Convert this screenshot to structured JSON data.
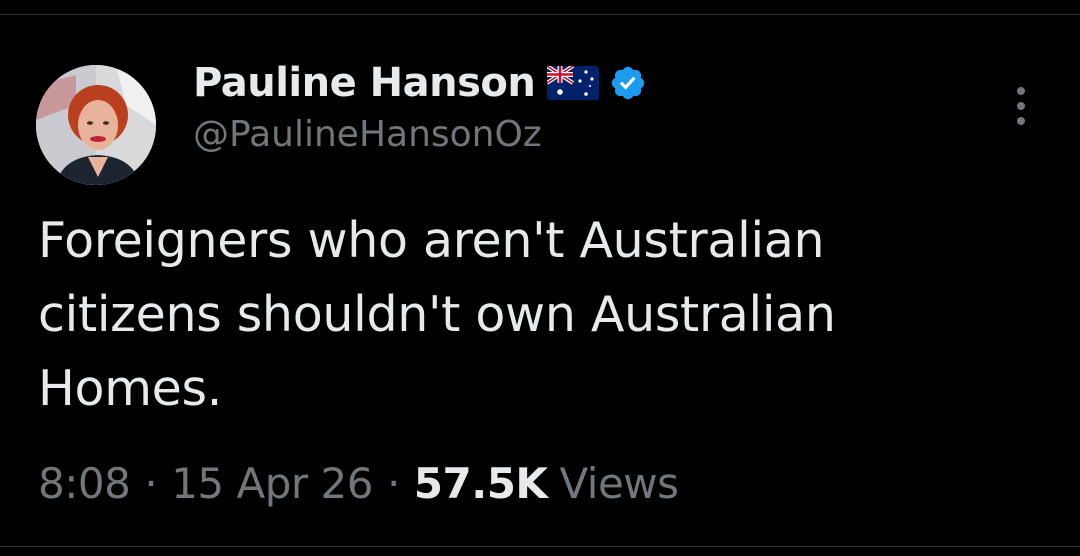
{
  "tweet": {
    "author": {
      "display_name": "Pauline Hanson",
      "handle": "@PaulineHansonOz",
      "avatar_icon": "profile-photo",
      "flag_icon": "australian-flag-emoji",
      "verified_icon": "verified-badge",
      "verified_color": "#1d9bf0"
    },
    "text_lines": [
      "Foreigners who aren't Australian",
      "citizens shouldn't own Australian",
      "Homes."
    ],
    "meta": {
      "time": "8:08",
      "separator": "·",
      "date": "15 Apr 26",
      "views_count": "57.5K",
      "views_label": "Views"
    },
    "more_icon": "more-vertical-icon"
  },
  "colors": {
    "background": "#000000",
    "primary_text": "#e7e9ea",
    "secondary_text": "#71767b",
    "divider": "#2f3336",
    "accent": "#1d9bf0"
  }
}
